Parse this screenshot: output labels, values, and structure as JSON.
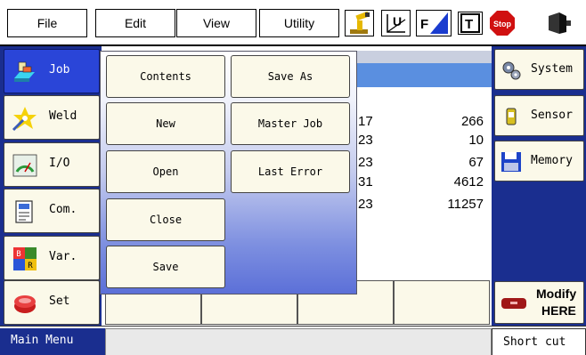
{
  "top_menu": {
    "file": "File",
    "edit": "Edit",
    "view": "View",
    "utility": "Utility",
    "tools": [
      {
        "icon": "robot-arm-icon"
      },
      {
        "icon": "user-frame-icon",
        "label": "U"
      },
      {
        "icon": "coordinate-icon",
        "label": "F"
      },
      {
        "icon": "tool-icon",
        "label": "T"
      },
      {
        "icon": "stop-icon",
        "label": "Stop"
      },
      {
        "icon": "servo-icon"
      }
    ]
  },
  "sidebar": {
    "items": [
      {
        "label": "Job",
        "icon": "job-icon",
        "active": true
      },
      {
        "label": "Weld",
        "icon": "weld-icon"
      },
      {
        "label": "I/O",
        "icon": "io-gauge-icon"
      },
      {
        "label": "Com.",
        "icon": "communication-icon"
      },
      {
        "label": "Var.",
        "icon": "variable-icon"
      },
      {
        "label": "Set",
        "icon": "settings-icon"
      }
    ]
  },
  "popup_menu": {
    "items": [
      {
        "label": "Contents"
      },
      {
        "label": "Save As"
      },
      {
        "label": "New"
      },
      {
        "label": "Master Job"
      },
      {
        "label": "Open"
      },
      {
        "label": "Last Error"
      },
      {
        "label": "Close"
      },
      {
        "label": "Save"
      }
    ]
  },
  "main": {
    "partial_values": [
      "17",
      "23",
      "23",
      "31",
      "23"
    ],
    "values": [
      "266",
      "10",
      "67",
      "4612",
      "11257"
    ]
  },
  "right_panel": {
    "items": [
      {
        "label": "System",
        "icon": "system-gears-icon"
      },
      {
        "label": "Sensor",
        "icon": "sensor-icon"
      },
      {
        "label": "Memory",
        "icon": "memory-floppy-icon"
      }
    ],
    "modify": {
      "line1": "Modify",
      "line2": "HERE"
    }
  },
  "status_bar": {
    "main_menu": "Main Menu",
    "short_cut": "Short cut"
  }
}
